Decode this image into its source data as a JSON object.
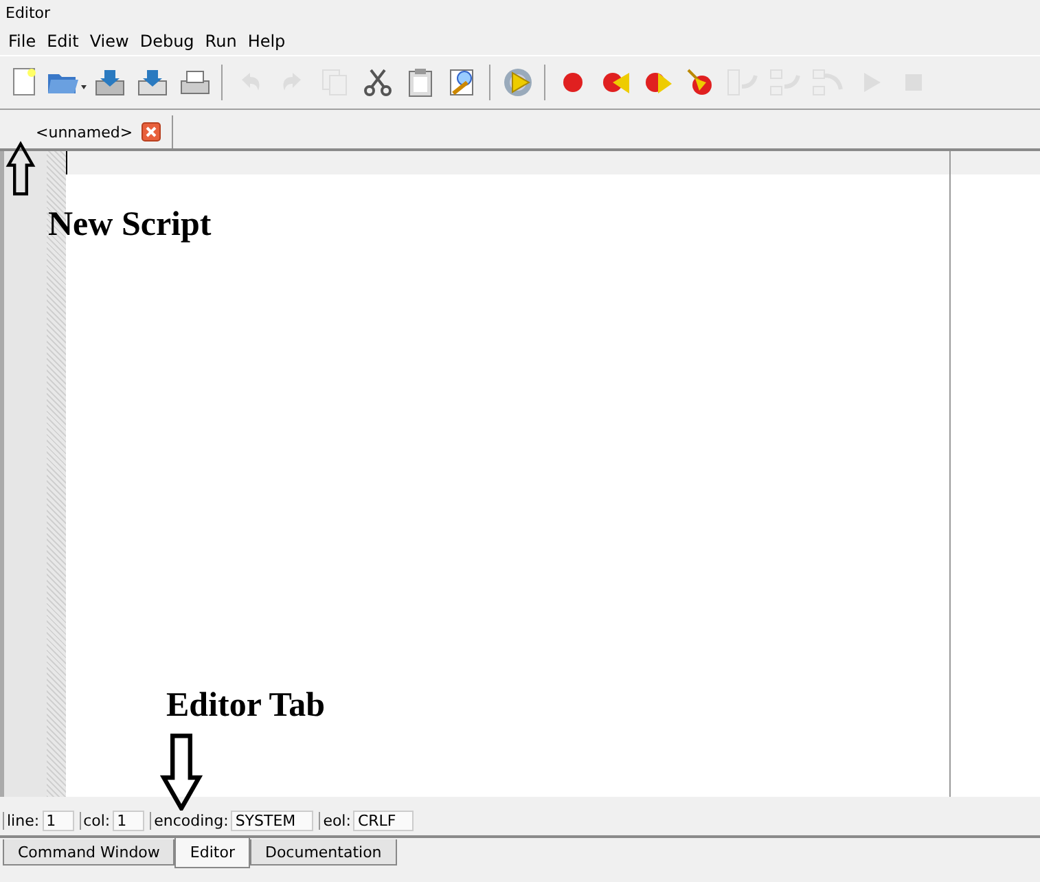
{
  "window": {
    "title": "Editor"
  },
  "menu": [
    "File",
    "Edit",
    "View",
    "Debug",
    "Run",
    "Help"
  ],
  "toolbar": [
    {
      "kind": "new",
      "disabled": false
    },
    {
      "kind": "open",
      "disabled": false
    },
    {
      "kind": "save",
      "disabled": false
    },
    {
      "kind": "saveas",
      "disabled": false
    },
    {
      "kind": "print",
      "disabled": false
    },
    {
      "kind": "sep"
    },
    {
      "kind": "undo",
      "disabled": true
    },
    {
      "kind": "redo",
      "disabled": true
    },
    {
      "kind": "copy",
      "disabled": true
    },
    {
      "kind": "cut",
      "disabled": false
    },
    {
      "kind": "paste",
      "disabled": false
    },
    {
      "kind": "find",
      "disabled": false
    },
    {
      "kind": "sep"
    },
    {
      "kind": "run",
      "disabled": false
    },
    {
      "kind": "sep"
    },
    {
      "kind": "breakpoint",
      "disabled": false
    },
    {
      "kind": "prevbp",
      "disabled": false
    },
    {
      "kind": "nextbp",
      "disabled": false
    },
    {
      "kind": "clearbp",
      "disabled": false
    },
    {
      "kind": "stepover",
      "disabled": true
    },
    {
      "kind": "stepin",
      "disabled": true
    },
    {
      "kind": "stepout",
      "disabled": true
    },
    {
      "kind": "continue",
      "disabled": true
    },
    {
      "kind": "stop",
      "disabled": true
    }
  ],
  "file_tabs": [
    {
      "label": "<unnamed>",
      "selected": true
    }
  ],
  "status_bar": [
    {
      "label": "line:",
      "value": "1"
    },
    {
      "label": "col:",
      "value": "1"
    },
    {
      "label": "encoding:",
      "value": "SYSTEM"
    },
    {
      "label": "eol:",
      "value": "CRLF"
    }
  ],
  "bottom_tabs": [
    {
      "label": "Command Window",
      "selected": false
    },
    {
      "label": "Editor",
      "selected": true
    },
    {
      "label": "Documentation",
      "selected": false
    }
  ],
  "annotations": [
    {
      "text": "New Script"
    },
    {
      "text": "Editor Tab"
    }
  ]
}
